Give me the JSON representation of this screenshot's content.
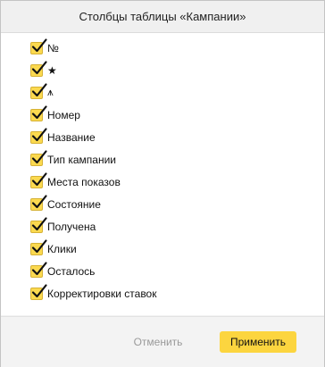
{
  "dialog": {
    "title": "Столбцы таблицы «Кампании»"
  },
  "columns": [
    {
      "label": "№",
      "checked": true
    },
    {
      "label": "★",
      "checked": true
    },
    {
      "label": "⩚",
      "checked": true
    },
    {
      "label": "Номер",
      "checked": true
    },
    {
      "label": "Название",
      "checked": true
    },
    {
      "label": "Тип кампании",
      "checked": true
    },
    {
      "label": "Места показов",
      "checked": true
    },
    {
      "label": "Состояние",
      "checked": true
    },
    {
      "label": "Получена",
      "checked": true
    },
    {
      "label": "Клики",
      "checked": true
    },
    {
      "label": "Осталось",
      "checked": true
    },
    {
      "label": "Корректировки ставок",
      "checked": true
    }
  ],
  "footer": {
    "cancel_label": "Отменить",
    "apply_label": "Применить"
  },
  "colors": {
    "accent_yellow": "#fcd53f",
    "checkbox_fill": "#fbd94f",
    "muted_text": "#9a9a9a"
  },
  "icons": {
    "checkbox_mark": "checkmark-icon"
  }
}
